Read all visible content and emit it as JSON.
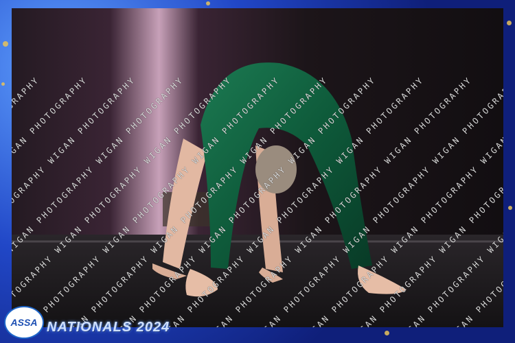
{
  "branding": {
    "logo_text": "ASSA",
    "event_title": "NATIONALS 2024"
  },
  "watermark": {
    "text": "WIGAN PHOTOGRAPHY"
  },
  "colors": {
    "frame_blue": "#1a2f8f",
    "leotard_green": "#0e5a3a",
    "stage_floor": "#1c1a1c",
    "curtain_pink": "#c7a0b8"
  }
}
